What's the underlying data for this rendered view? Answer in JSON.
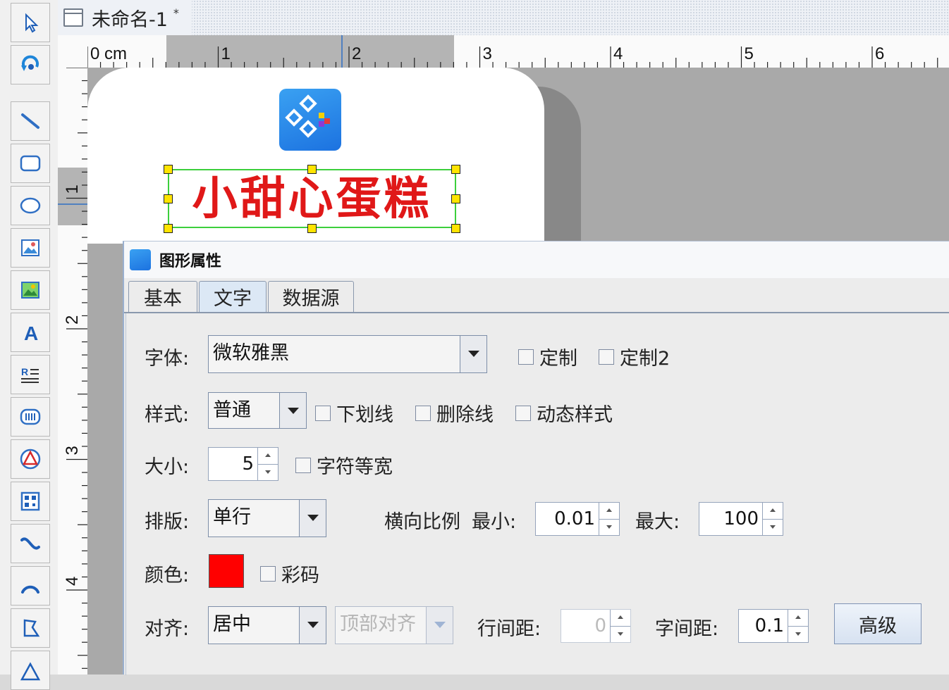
{
  "document": {
    "title": "未命名-1",
    "modified_mark": "*"
  },
  "ruler": {
    "h_labels": [
      "0 cm",
      "1",
      "2",
      "3",
      "4",
      "5",
      "6"
    ],
    "v_labels": [
      "1",
      "2",
      "3",
      "4"
    ]
  },
  "toolbar": {
    "tools": [
      {
        "name": "select-tool",
        "icon": "cursor-arrow-icon"
      },
      {
        "name": "rotate-tool",
        "icon": "rotate-icon"
      },
      {
        "name": "line-tool",
        "icon": "line-icon"
      },
      {
        "name": "rounded-rect-tool",
        "icon": "rounded-rectangle-icon"
      },
      {
        "name": "ellipse-tool",
        "icon": "ellipse-icon"
      },
      {
        "name": "image-tool",
        "icon": "picture-icon"
      },
      {
        "name": "image2-tool",
        "icon": "picture-color-icon"
      },
      {
        "name": "text-tool",
        "icon": "text-a-icon"
      },
      {
        "name": "rich-text-tool",
        "icon": "rich-text-icon"
      },
      {
        "name": "barcode-tool",
        "icon": "barcode-icon"
      },
      {
        "name": "shape-tool",
        "icon": "triangle-circle-icon"
      },
      {
        "name": "qrcode-tool",
        "icon": "qrcode-icon"
      },
      {
        "name": "curve-tool",
        "icon": "curve-icon"
      },
      {
        "name": "arc-tool",
        "icon": "arc-icon"
      },
      {
        "name": "polygon-tool",
        "icon": "polygon-icon"
      },
      {
        "name": "triangle-tool",
        "icon": "triangle-icon"
      }
    ]
  },
  "label": {
    "text": "小甜心蛋糕",
    "text_color": "#e01818"
  },
  "dialog": {
    "title": "图形属性",
    "tabs": [
      "基本",
      "文字",
      "数据源"
    ],
    "active_tab": "文字",
    "font_label": "字体:",
    "font_value": "微软雅黑",
    "custom_label": "定制",
    "custom2_label": "定制2",
    "style_label": "样式:",
    "style_value": "普通",
    "underline_label": "下划线",
    "strike_label": "删除线",
    "dynamic_style_label": "动态样式",
    "size_label": "大小:",
    "size_value": "5",
    "monospace_label": "字符等宽",
    "layout_label": "排版:",
    "layout_value": "单行",
    "hscale_label": "横向比例",
    "min_label": "最小:",
    "min_value": "0.01",
    "max_label": "最大:",
    "max_value": "100",
    "color_label": "颜色:",
    "color_value": "#ff0000",
    "colorcode_label": "彩码",
    "align_label": "对齐:",
    "align_value": "居中",
    "valign_value": "顶部对齐",
    "line_spacing_label": "行间距:",
    "line_spacing_value": "0",
    "char_spacing_label": "字间距:",
    "char_spacing_value": "0.1",
    "advanced_label": "高级"
  }
}
